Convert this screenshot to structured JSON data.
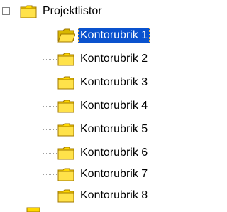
{
  "tree": {
    "root": {
      "label": "Projektlistor",
      "expanded": true,
      "icon": "folder-closed-icon"
    },
    "children": [
      {
        "label": "Kontorubrik 1",
        "selected": true,
        "icon": "folder-open-icon"
      },
      {
        "label": "Kontorubrik 2",
        "selected": false,
        "icon": "folder-closed-icon"
      },
      {
        "label": "Kontorubrik 3",
        "selected": false,
        "icon": "folder-closed-icon"
      },
      {
        "label": "Kontorubrik 4",
        "selected": false,
        "icon": "folder-closed-icon"
      },
      {
        "label": "Kontorubrik 5",
        "selected": false,
        "icon": "folder-closed-icon"
      },
      {
        "label": "Kontorubrik 6",
        "selected": false,
        "icon": "folder-closed-icon"
      },
      {
        "label": "Kontorubrik 7",
        "selected": false,
        "icon": "folder-closed-icon"
      },
      {
        "label": "Kontorubrik 8",
        "selected": false,
        "icon": "folder-closed-icon"
      }
    ]
  },
  "colors": {
    "selection_bg": "#0a52ce",
    "selection_text": "#ffffff",
    "folder_fill": "#ffd800",
    "folder_edge": "#a07800",
    "tree_lines": "#a0a0a0"
  }
}
